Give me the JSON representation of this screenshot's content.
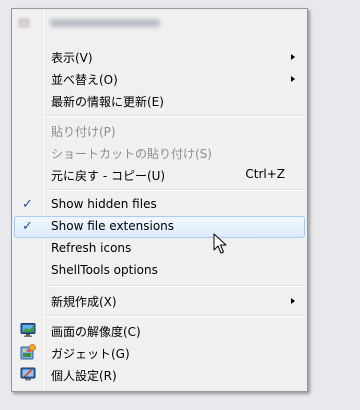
{
  "menu": {
    "items": [
      {
        "label": "表示(V)",
        "submenu": true
      },
      {
        "label": "並べ替え(O)",
        "submenu": true
      },
      {
        "label": "最新の情報に更新(E)"
      },
      {
        "label": "貼り付け(P)",
        "disabled": true
      },
      {
        "label": "ショートカットの貼り付け(S)",
        "disabled": true
      },
      {
        "label": "元に戻す - コピー(U)",
        "shortcut": "Ctrl+Z"
      },
      {
        "label": "Show hidden files",
        "checked": true
      },
      {
        "label": "Show file extensions",
        "checked": true,
        "highlighted": true
      },
      {
        "label": "Refresh icons"
      },
      {
        "label": "ShellTools options"
      },
      {
        "label": "新規作成(X)",
        "submenu": true
      },
      {
        "label": "画面の解像度(C)",
        "icon": "monitor-icon"
      },
      {
        "label": "ガジェット(G)",
        "icon": "gadget-icon"
      },
      {
        "label": "個人設定(R)",
        "icon": "personalize-icon"
      }
    ]
  },
  "colors": {
    "highlight_border": "#a9cbf1",
    "check_color": "#1b53a8",
    "disabled_text": "#8d8d8d"
  }
}
